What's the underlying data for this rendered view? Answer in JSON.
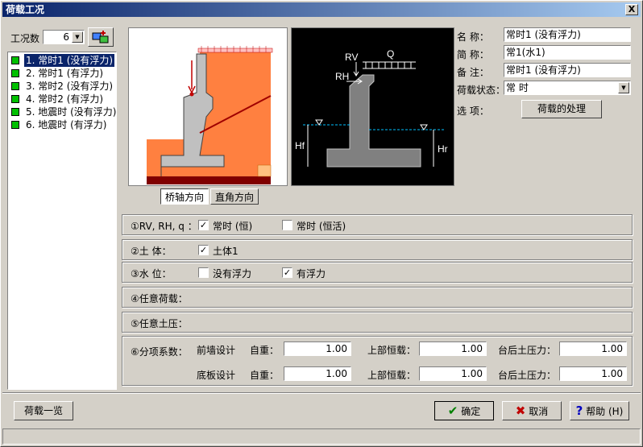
{
  "window": {
    "title": "荷载工况",
    "close_label": "X"
  },
  "case_count": {
    "label": "工况数",
    "value": "6",
    "arrow": "▼"
  },
  "case_list": [
    {
      "label": "1. 常时1 (没有浮力)",
      "selected": true
    },
    {
      "label": "2. 常时1 (有浮力)",
      "selected": false
    },
    {
      "label": "3. 常时2 (没有浮力)",
      "selected": false
    },
    {
      "label": "4. 常时2 (有浮力)",
      "selected": false
    },
    {
      "label": "5. 地震时 (没有浮力)",
      "selected": false
    },
    {
      "label": "6. 地震时 (有浮力)",
      "selected": false
    }
  ],
  "direction_tabs": {
    "bridge_axis": "桥轴方向",
    "right_angle": "直角方向"
  },
  "load_diagram": {
    "rv": "RV",
    "rh": "RH",
    "q": "Q",
    "hf": "Hf",
    "hr": "Hr"
  },
  "properties": {
    "name_label": "名    称：",
    "name_value": "常时1 (没有浮力)",
    "short_label": "简    称：",
    "short_value": "常1(水1)",
    "note_label": "备    注：",
    "note_value": "常时1 (没有浮力)",
    "state_label": "荷载状态：",
    "state_value": "常  时",
    "option_label": "选    项：",
    "process_button": "荷载的处理"
  },
  "row_rv": {
    "label": "①RV, RH, q ：",
    "opt1": "常时 (恒)",
    "opt1_checked": true,
    "opt2": "常时 (恒活)",
    "opt2_checked": false
  },
  "row_soil": {
    "label": "②土    体：",
    "opt1": "土体1",
    "opt1_checked": true
  },
  "row_water": {
    "label": "③水    位：",
    "opt1": "没有浮力",
    "opt1_checked": false,
    "opt2": "有浮力",
    "opt2_checked": true
  },
  "row_any_load": {
    "label": "④任意荷载："
  },
  "row_any_soil": {
    "label": "⑤任意土压："
  },
  "row_factors": {
    "label": "⑥分项系数：",
    "rows": [
      {
        "name": "前墙设计",
        "self_label": "自重：",
        "self": "1.00",
        "upper_label": "上部恒载：",
        "upper": "1.00",
        "back_label": "台后土压力：",
        "back": "1.00"
      },
      {
        "name": "底板设计",
        "self_label": "自重：",
        "self": "1.00",
        "upper_label": "上部恒载：",
        "upper": "1.00",
        "back_label": "台后土压力：",
        "back": "1.00"
      }
    ]
  },
  "buttons": {
    "list": "荷载一览",
    "ok": "确定",
    "cancel": "取消",
    "help": "帮助 (H)"
  },
  "colors": {
    "soil": "#ff8040",
    "concrete": "#c0c0c0",
    "base": "#800000",
    "title_bar": "#0a246a"
  }
}
